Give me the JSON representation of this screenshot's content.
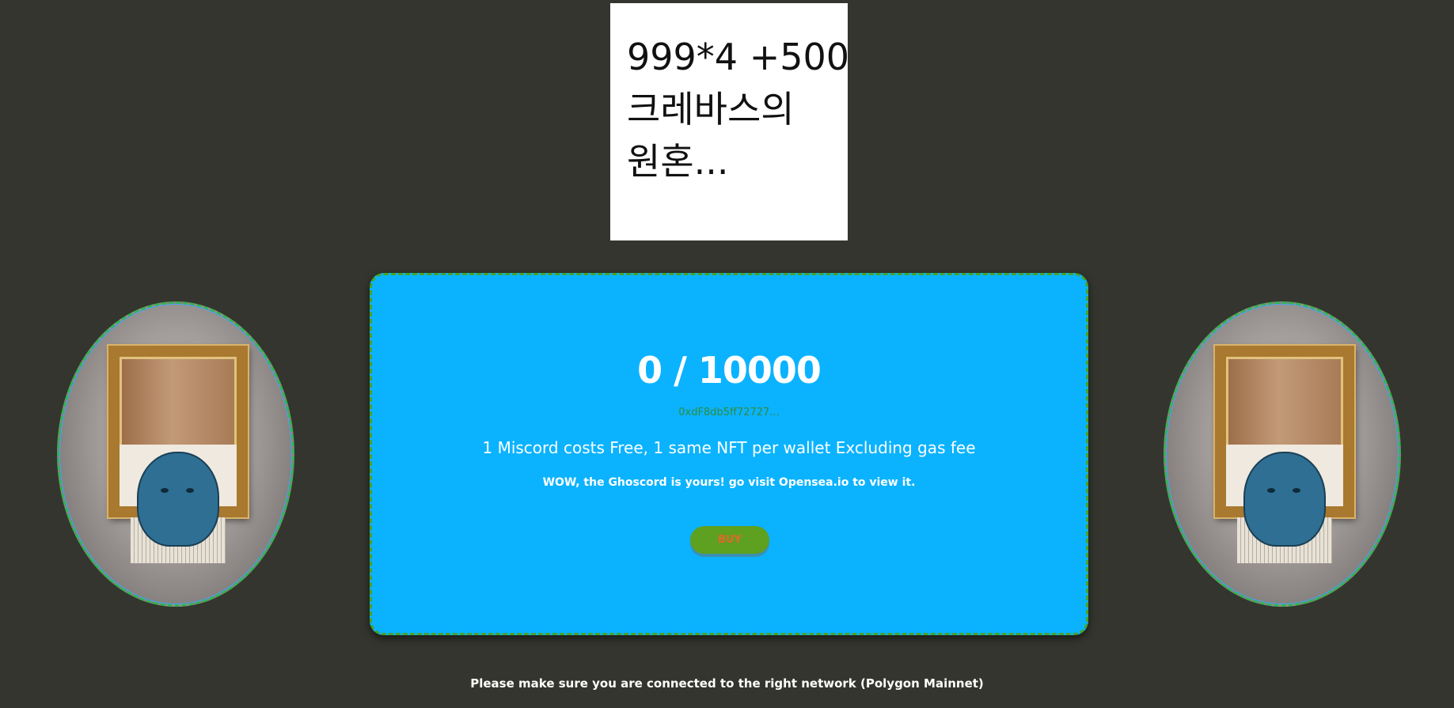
{
  "note": {
    "lines": [
      "999*4  +500",
      "크레바스의",
      "원혼..."
    ]
  },
  "mint": {
    "counter": "0 / 10000",
    "address": "0xdF8db5ff72727...",
    "price_text": "1 Miscord costs Free, 1 same NFT per wallet Excluding gas fee",
    "success_text": "WOW, the Ghoscord is yours! go visit Opensea.io to view it.",
    "buy_label": "BUY"
  },
  "footer": {
    "network_notice": "Please make sure you are connected to the right network (Polygon Mainnet)"
  },
  "colors": {
    "background": "#34352e",
    "card": "#0bb3ff",
    "card_border": "#46a32a",
    "buy_button": "#5ea01f",
    "buy_text": "#e1692a",
    "address_text": "#2f8c3a"
  },
  "images": {
    "left": "framed-ghost-artwork",
    "right": "framed-ghost-artwork"
  }
}
